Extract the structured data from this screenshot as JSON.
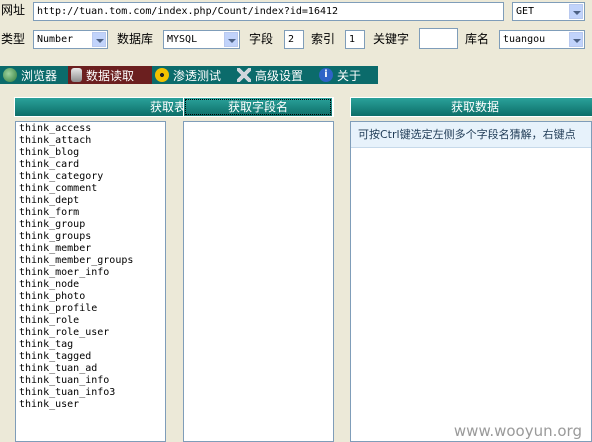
{
  "row1": {
    "url_label": "网址",
    "url_value": "http://tuan.tom.com/index.php/Count/index?id=16412",
    "method": "GET"
  },
  "row2": {
    "type_label": "类型",
    "type_value": "Number",
    "db_label": "数据库",
    "db_value": "MYSQL",
    "field_label": "字段",
    "field_value": "2",
    "index_label": "索引",
    "index_value": "1",
    "keyword_label": "关键字",
    "keyword_value": "",
    "dbname_label": "库名",
    "dbname_value": "tuangou"
  },
  "tabs": [
    {
      "label": "浏览器",
      "icon": "globe-icon"
    },
    {
      "label": "数据读取",
      "icon": "database-icon"
    },
    {
      "label": "渗透测试",
      "icon": "radiation-icon"
    },
    {
      "label": "高级设置",
      "icon": "tools-icon"
    },
    {
      "label": "关于",
      "icon": "info-icon"
    }
  ],
  "panels": {
    "tables_header": "获取表名",
    "fields_header": "获取字段名",
    "data_header": "获取数据",
    "data_hint": "可按Ctrl键选定左侧多个字段名猜解，右键点"
  },
  "tables": [
    "think_access",
    "think_attach",
    "think_blog",
    "think_card",
    "think_category",
    "think_comment",
    "think_dept",
    "think_form",
    "think_group",
    "think_groups",
    "think_member",
    "think_member_groups",
    "think_moer_info",
    "think_node",
    "think_photo",
    "think_profile",
    "think_role",
    "think_role_user",
    "think_tag",
    "think_tagged",
    "think_tuan_ad",
    "think_tuan_info",
    "think_tuan_info3",
    "think_user"
  ],
  "watermark": "www.wooyun.org",
  "colors": {
    "tab_bar": "#0b6b6b",
    "tab_active": "#6b1f1f",
    "panel_head": "#1a8a84"
  }
}
